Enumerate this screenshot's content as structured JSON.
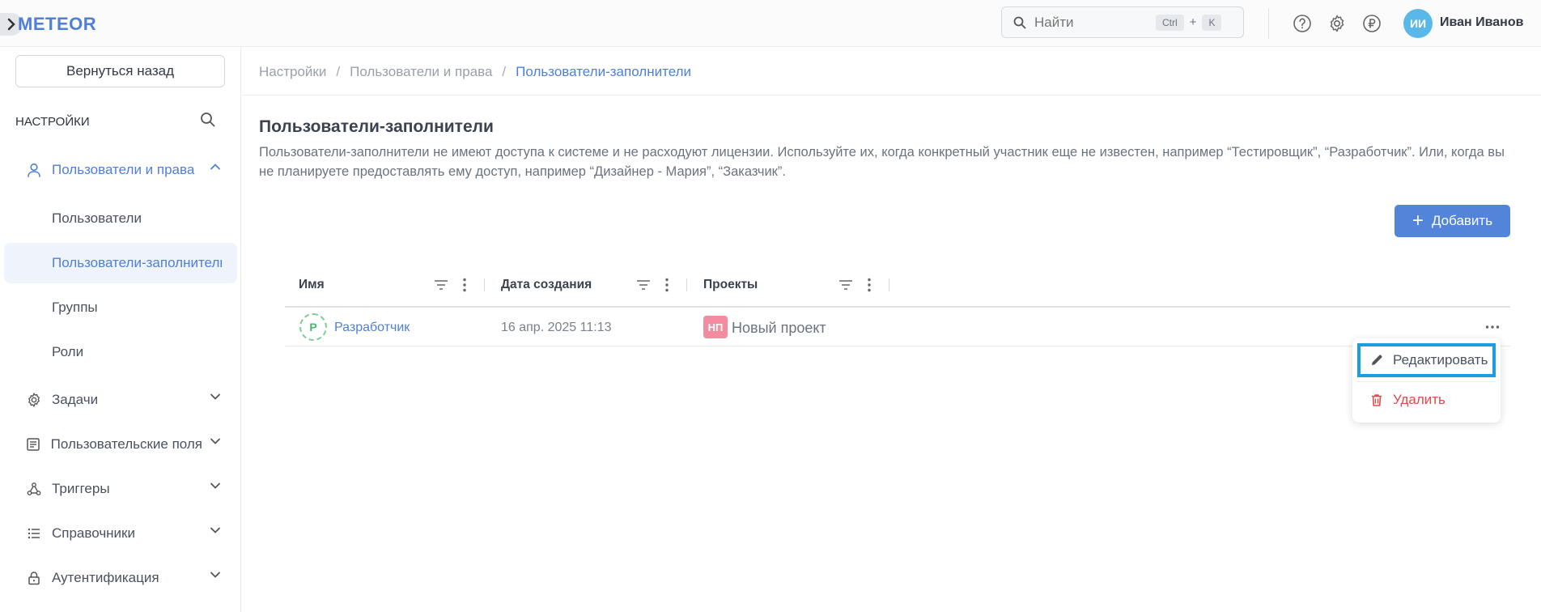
{
  "header": {
    "logo": "METEOR",
    "search_placeholder": "Найти",
    "shortcut_ctrl": "Ctrl",
    "shortcut_plus": "+",
    "shortcut_key": "K",
    "user_initials": "ИИ",
    "user_name": "Иван Иванов",
    "icons": [
      "help-icon",
      "gear-icon",
      "ruble-icon"
    ]
  },
  "sidebar": {
    "back_label": "Вернуться назад",
    "title": "НАСТРОЙКИ",
    "groups": [
      {
        "label": "Пользователи и права",
        "icon": "user-icon",
        "expanded": true,
        "children": [
          "Пользователи",
          "Пользователи-заполнители",
          "Группы",
          "Роли"
        ]
      },
      {
        "label": "Задачи",
        "icon": "gear-icon"
      },
      {
        "label": "Пользовательские поля",
        "icon": "form-icon"
      },
      {
        "label": "Триггеры",
        "icon": "trigger-icon"
      },
      {
        "label": "Справочники",
        "icon": "list-icon"
      },
      {
        "label": "Аутентификация",
        "icon": "lock-icon"
      }
    ]
  },
  "breadcrumb": [
    "Настройки",
    "Пользователи и права",
    "Пользователи-заполнители"
  ],
  "page": {
    "title": "Пользователи-заполнители",
    "description": "Пользователи-заполнители не имеют доступа к системе и не расходуют лицензии. Используйте их, когда конкретный участник еще не известен, например “Тестировщик”, “Разработчик”. Или, когда вы не планируете предоставлять ему доступ, например “Дизайнер - Мария”, “Заказчик”.",
    "add_label": "Добавить"
  },
  "table": {
    "columns": [
      "Имя",
      "Дата создания",
      "Проекты"
    ],
    "rows": [
      {
        "avatar": "Р",
        "name": "Разработчик",
        "date": "16 апр. 2025 11:13",
        "project_badge": "НП",
        "project": "Новый проект"
      }
    ]
  },
  "context_menu": {
    "edit_label": "Редактировать",
    "delete_label": "Удалить"
  },
  "colors": {
    "accent": "#4f7fd7",
    "danger": "#e14a4a",
    "highlight": "#1a9ee0"
  }
}
